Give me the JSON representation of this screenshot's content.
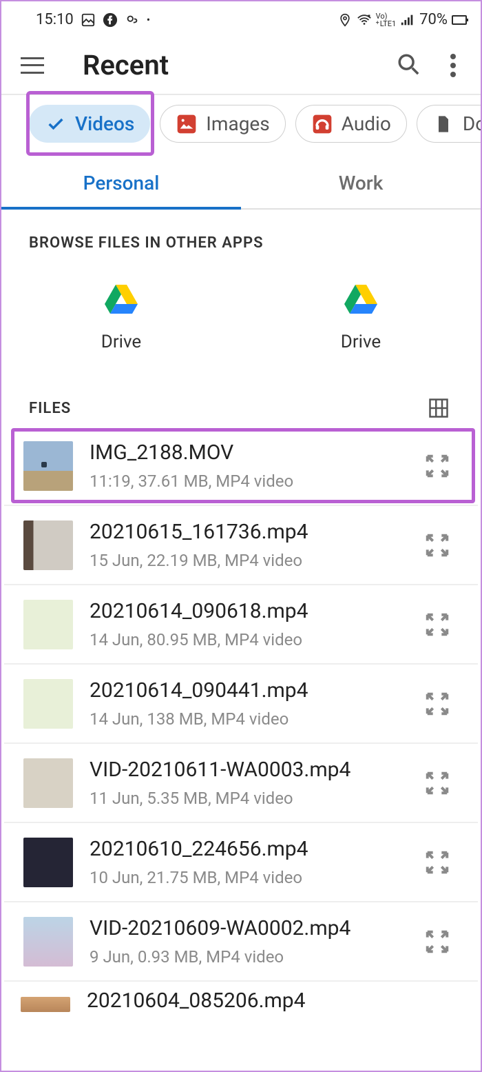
{
  "statusbar": {
    "time": "15:10",
    "battery": "70%",
    "lte_top": "Vo)",
    "lte_bottom": "LTE1"
  },
  "toolbar": {
    "title": "Recent"
  },
  "chips": [
    {
      "label": "Videos",
      "selected": true,
      "icon": "check"
    },
    {
      "label": "Images",
      "selected": false,
      "icon": "image"
    },
    {
      "label": "Audio",
      "selected": false,
      "icon": "audio"
    },
    {
      "label": "Doc",
      "selected": false,
      "icon": "doc"
    }
  ],
  "tabs": [
    {
      "label": "Personal",
      "active": true
    },
    {
      "label": "Work",
      "active": false
    }
  ],
  "browse": {
    "header": "BROWSE FILES IN OTHER APPS",
    "apps": [
      {
        "label": "Drive"
      },
      {
        "label": "Drive"
      }
    ]
  },
  "files_header": "FILES",
  "files": [
    {
      "name": "IMG_2188.MOV",
      "meta": "11:19, 37.61 MB, MP4 video",
      "thumb": "t-sky",
      "highlight": true
    },
    {
      "name": "20210615_161736.mp4",
      "meta": "15 Jun, 22.19 MB, MP4 video",
      "thumb": "t-room",
      "highlight": false
    },
    {
      "name": "20210614_090618.mp4",
      "meta": "14 Jun, 80.95 MB, MP4 video",
      "thumb": "t-green",
      "highlight": false
    },
    {
      "name": "20210614_090441.mp4",
      "meta": "14 Jun, 138 MB, MP4 video",
      "thumb": "t-green",
      "highlight": false
    },
    {
      "name": "VID-20210611-WA0003.mp4",
      "meta": "11 Jun, 5.35 MB, MP4 video",
      "thumb": "t-statue",
      "highlight": false
    },
    {
      "name": "20210610_224656.mp4",
      "meta": "10 Jun, 21.75 MB, MP4 video",
      "thumb": "t-dark",
      "highlight": false
    },
    {
      "name": "VID-20210609-WA0002.mp4",
      "meta": "9 Jun, 0.93 MB, MP4 video",
      "thumb": "t-blue",
      "highlight": false
    }
  ],
  "partial_file": {
    "name": "20210604_085206.mp4"
  }
}
